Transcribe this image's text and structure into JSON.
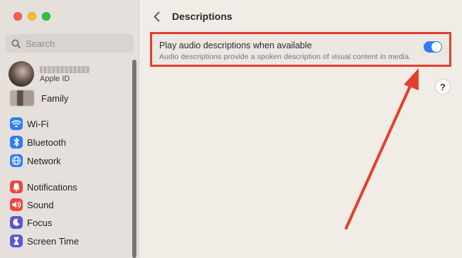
{
  "window": {
    "traffic_lights": [
      "close",
      "minimize",
      "zoom"
    ]
  },
  "sidebar": {
    "search": {
      "placeholder": "Search"
    },
    "profile": {
      "subtitle": "Apple ID"
    },
    "family_label": "Family",
    "items": [
      {
        "label": "Wi-Fi",
        "icon": "wifi-icon",
        "color": "#2f7df6"
      },
      {
        "label": "Bluetooth",
        "icon": "bluetooth-icon",
        "color": "#2f7df6"
      },
      {
        "label": "Network",
        "icon": "globe-icon",
        "color": "#2f7df6"
      },
      {
        "label": "Notifications",
        "icon": "bell-icon",
        "color": "#e9483f"
      },
      {
        "label": "Sound",
        "icon": "speaker-icon",
        "color": "#e9483f"
      },
      {
        "label": "Focus",
        "icon": "moon-icon",
        "color": "#5b56d6"
      },
      {
        "label": "Screen Time",
        "icon": "hourglass-icon",
        "color": "#5b56d6"
      }
    ]
  },
  "header": {
    "title": "Descriptions"
  },
  "setting": {
    "title": "Play audio descriptions when available",
    "description": "Audio descriptions provide a spoken description of visual content in media.",
    "enabled": true
  },
  "help": {
    "label": "?"
  },
  "colors": {
    "highlight": "#e1412c",
    "toggle_on": "#2f7df6"
  }
}
